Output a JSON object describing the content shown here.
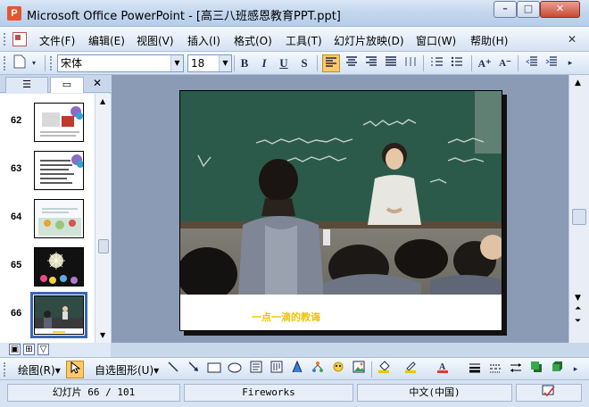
{
  "window": {
    "title": "Microsoft Office PowerPoint - [高三八班感恩教育PPT.ppt]",
    "app_icon_letter": "P",
    "min_glyph": "–",
    "max_glyph": "□",
    "close_glyph": "✕"
  },
  "menu": {
    "items": [
      "文件(F)",
      "编辑(E)",
      "视图(V)",
      "插入(I)",
      "格式(O)",
      "工具(T)",
      "幻灯片放映(D)",
      "窗口(W)",
      "帮助(H)"
    ],
    "close_doc": "✕"
  },
  "format_toolbar": {
    "font_name": "宋体",
    "font_size": "18",
    "bold": "B",
    "italic": "I",
    "underline": "U",
    "shadow": "S",
    "grow_font": "A⁺",
    "shrink_font": "A⁻"
  },
  "left_panel": {
    "tab_outline_glyph": "☰",
    "tab_slides_glyph": "▭",
    "close_glyph": "✕",
    "thumbnails": [
      {
        "number": "62",
        "selected": false
      },
      {
        "number": "63",
        "selected": false
      },
      {
        "number": "64",
        "selected": false
      },
      {
        "number": "65",
        "selected": false
      },
      {
        "number": "66",
        "selected": true
      }
    ]
  },
  "slide": {
    "caption": "一点一滴的教诲"
  },
  "drawing_toolbar": {
    "draw_label": "绘图(R)▾",
    "autoshapes_label": "自选图形(U)▾"
  },
  "status": {
    "slide_counter": "幻灯片 66 / 101",
    "design": "Fireworks",
    "language": "中文(中国)"
  },
  "colors": {
    "accent_selected": "#3a67b1",
    "caption_color": "#f2c300",
    "workspace_bg": "#8c9bb5"
  }
}
